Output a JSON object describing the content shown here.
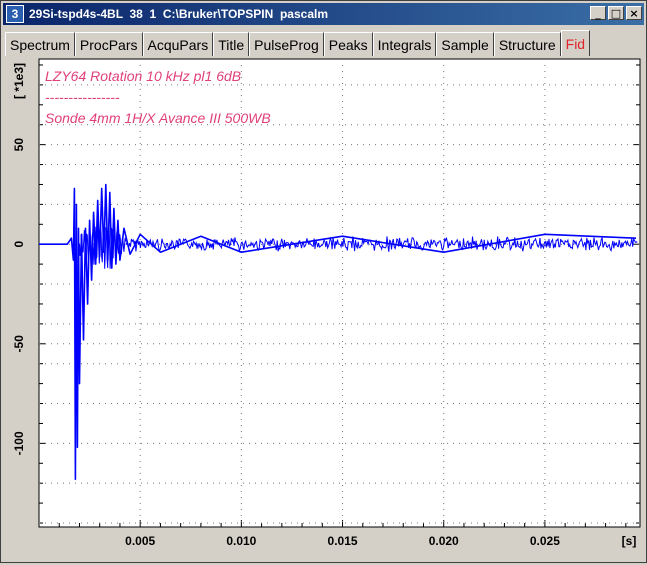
{
  "window": {
    "icon_label": "3",
    "title": "29Si-tspd4s-4BL  38  1  C:\\Bruker\\TOPSPIN  pascalm",
    "buttons": {
      "minimize": "_",
      "maximize": "□",
      "close": "×"
    }
  },
  "tabs": [
    "Spectrum",
    "ProcPars",
    "AcquPars",
    "Title",
    "PulseProg",
    "Peaks",
    "Integrals",
    "Sample",
    "Structure",
    "Fid"
  ],
  "active_tab": "Fid",
  "colors": {
    "trace": "#0000ff",
    "annotation": "#e0407a",
    "active_tab": "#e0242b",
    "titlebar": "#0a246a"
  },
  "chart_data": {
    "type": "line",
    "title_lines": [
      "LZY64 Rotation 10 kHz pl1 6dB",
      "----------------",
      "Sonde 4mm 1H/X Avance III 500WB"
    ],
    "xlabel": "[s]",
    "ylabel": "[ *1e3]",
    "xlim": [
      0.0,
      0.0297
    ],
    "ylim": [
      -142,
      93
    ],
    "x_ticks": [
      0.005,
      0.01,
      0.015,
      0.02,
      0.025
    ],
    "x_tick_labels": [
      "0.005",
      "0.010",
      "0.015",
      "0.020",
      "0.025"
    ],
    "y_ticks": [
      50,
      0,
      -50,
      -100
    ],
    "y_tick_labels": [
      "50",
      "0",
      "-50",
      "-100"
    ],
    "grid": true,
    "series": [
      {
        "x": [
          0.0,
          0.0014,
          0.0016,
          0.0017,
          0.00175,
          0.0018,
          0.00185,
          0.0019,
          0.00195,
          0.002,
          0.0021,
          0.0022,
          0.0023,
          0.0024,
          0.0025,
          0.0026,
          0.0027,
          0.0028,
          0.0029,
          0.003,
          0.0031,
          0.0032,
          0.0033,
          0.0034,
          0.0035,
          0.0036,
          0.0037,
          0.0038,
          0.0039,
          0.004,
          0.0042,
          0.0045,
          0.005,
          0.006,
          0.008,
          0.01,
          0.015,
          0.02,
          0.025,
          0.0295
        ],
        "y": [
          0,
          0,
          3,
          -8,
          28,
          -118,
          20,
          -102,
          8,
          -70,
          5,
          -48,
          8,
          -30,
          12,
          -18,
          16,
          -10,
          22,
          -6,
          28,
          -4,
          30,
          -8,
          26,
          -12,
          18,
          -10,
          12,
          -8,
          8,
          -5,
          5,
          -4,
          4,
          -4,
          4,
          -4,
          5,
          3
        ]
      }
    ]
  }
}
